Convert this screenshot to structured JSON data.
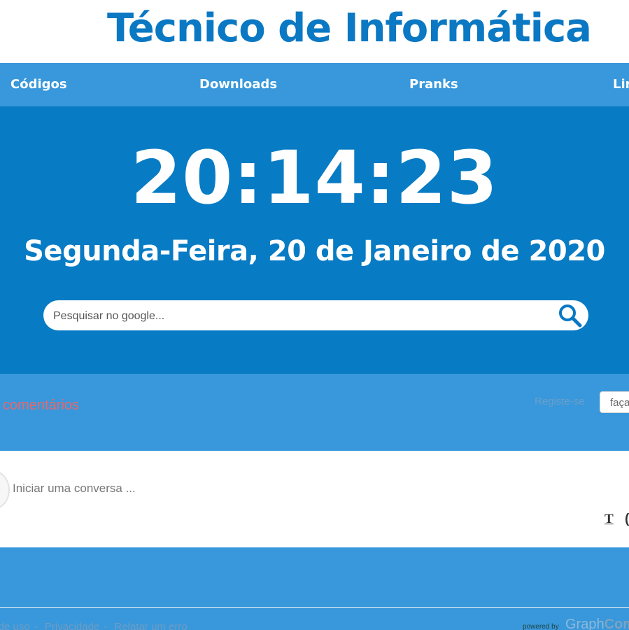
{
  "site": {
    "title": "Técnico de Informática"
  },
  "nav": {
    "items": [
      {
        "label": "Códigos"
      },
      {
        "label": "Downloads"
      },
      {
        "label": "Pranks"
      },
      {
        "label": "Lin"
      }
    ]
  },
  "hero": {
    "time": "20:14:23",
    "date": "Segunda-Feira, 20 de Janeiro de 2020",
    "search_placeholder": "Pesquisar no google...",
    "search_icon": "search-icon"
  },
  "comments": {
    "count_label": "comentários",
    "register_label": "Registe-se",
    "login_placeholder": "faça",
    "conversation_placeholder": "Iniciar uma conversa ...",
    "format_icon": "text-format-icon"
  },
  "footer": {
    "links": [
      "s de uso",
      "Privacidade",
      "Relatar um erro"
    ],
    "powered_by": "powered by",
    "brand_light": "Graph",
    "brand_bold": "Com"
  },
  "colors": {
    "brand_blue": "#0a78c3",
    "nav_blue": "#3898db",
    "hero_blue": "#077bc4",
    "comment_count_red": "#e9686a"
  }
}
